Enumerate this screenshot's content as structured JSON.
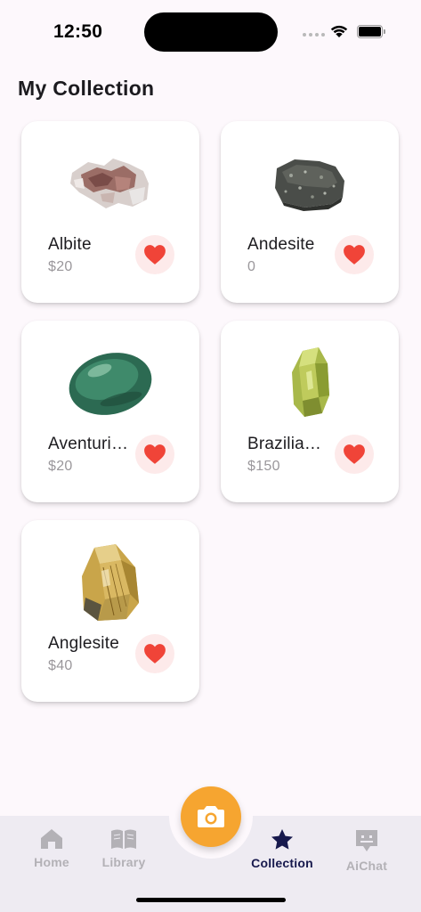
{
  "status_bar": {
    "time": "12:50",
    "icons": [
      "signal-dots-icon",
      "wifi-icon",
      "battery-icon"
    ]
  },
  "page": {
    "title": "My Collection"
  },
  "items": [
    {
      "name": "Albite",
      "price": "$20",
      "image": "albite-rock-image",
      "favorite": true
    },
    {
      "name": "Andesite",
      "price": "0",
      "image": "andesite-rock-image",
      "favorite": true
    },
    {
      "name": "Aventurine",
      "price": "$20",
      "image": "aventurine-stone-image",
      "favorite": true
    },
    {
      "name": "Brazilianite",
      "price": "$150",
      "image": "brazilianite-crystal-image",
      "favorite": true
    },
    {
      "name": "Anglesite",
      "price": "$40",
      "image": "anglesite-crystal-image",
      "favorite": true
    }
  ],
  "bottom_nav": {
    "items": [
      {
        "label": "Home",
        "icon": "home-icon",
        "active": false
      },
      {
        "label": "Library",
        "icon": "book-icon",
        "active": false
      },
      {
        "label": "Collection",
        "icon": "star-icon",
        "active": true
      },
      {
        "label": "AiChat",
        "icon": "chat-bot-icon",
        "active": false
      }
    ],
    "fab_icon": "camera-icon"
  },
  "colors": {
    "background": "#fdf8fc",
    "accent_orange": "#f6a530",
    "heart_red": "#f04438",
    "heart_bg": "#fdeaea",
    "nav_active": "#17194d",
    "nav_inactive": "#b3b1b6"
  }
}
